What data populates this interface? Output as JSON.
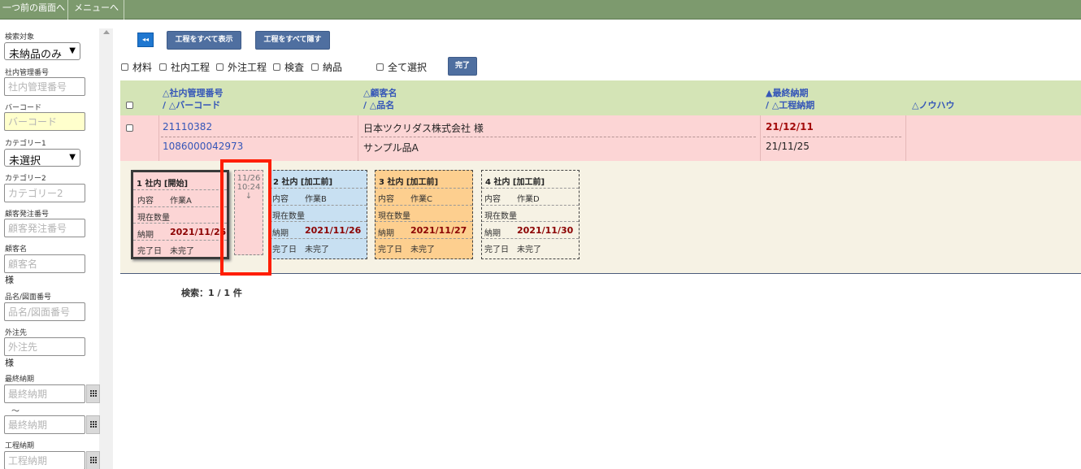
{
  "topbar": {
    "back_label": "一つ前の画面へ",
    "menu_label": "メニューへ"
  },
  "sidebar": {
    "search_target_label": "検索対象",
    "search_target_value": "未納品のみ",
    "internal_no_label": "社内管理番号",
    "internal_no_placeholder": "社内管理番号",
    "barcode_label": "バーコード",
    "barcode_placeholder": "バーコード",
    "category1_label": "カテゴリー1",
    "category1_value": "未選択",
    "category2_label": "カテゴリー2",
    "category2_placeholder": "カテゴリー2",
    "customer_po_label": "顧客発注番号",
    "customer_po_placeholder": "顧客発注番号",
    "customer_label": "顧客名",
    "customer_placeholder": "顧客名",
    "customer_suffix": "様",
    "product_label": "品名/図面番号",
    "product_placeholder": "品名/図面番号",
    "vendor_label": "外注先",
    "vendor_placeholder": "外注先",
    "vendor_suffix": "様",
    "final_due_label": "最終納期",
    "final_due_from_placeholder": "最終納期",
    "range_sep": "～",
    "final_due_to_placeholder": "最終納期",
    "proc_due_label": "工程納期",
    "proc_due_placeholder": "工程納期"
  },
  "toolbar": {
    "rewind_icon": "◂◂",
    "show_all_label": "工程をすべて表示",
    "hide_all_label": "工程をすべて隠す",
    "filters": [
      "材料",
      "社内工程",
      "外注工程",
      "検査",
      "納品"
    ],
    "select_all_label": "全て選択",
    "done_label": "完了"
  },
  "table": {
    "headers": {
      "internal_no": "△社内管理番号",
      "barcode": "/ △バーコード",
      "customer": "△顧客名",
      "product": "/ △品名",
      "final_due": "▲最終納期",
      "proc_due": "/ △工程納期",
      "knowhow": "△ノウハウ"
    },
    "row": {
      "internal_no": "21110382",
      "barcode": "1086000042973",
      "customer": "日本ツクリダス株式会社 様",
      "product": "サンプル品A",
      "final_due": "21/12/11",
      "proc_due": "21/11/25"
    }
  },
  "processes": [
    {
      "title": "1 社内 [開始]",
      "content_label": "内容",
      "content": "作業A",
      "qty_label": "現在数量",
      "due_label": "納期",
      "due": "2021/11/25",
      "done_label": "完了日",
      "done": "未完了"
    },
    {
      "title": "2 社内 [加工前]",
      "content_label": "内容",
      "content": "作業B",
      "qty_label": "現在数量",
      "due_label": "納期",
      "due": "2021/11/26",
      "done_label": "完了日",
      "done": "未完了"
    },
    {
      "title": "3 社内 [加工前]",
      "content_label": "内容",
      "content": "作業C",
      "qty_label": "現在数量",
      "due_label": "納期",
      "due": "2021/11/27",
      "done_label": "完了日",
      "done": "未完了"
    },
    {
      "title": "4 社内 [加工前]",
      "content_label": "内容",
      "content": "作業D",
      "qty_label": "現在数量",
      "due_label": "納期",
      "due": "2021/11/30",
      "done_label": "完了日",
      "done": "未完了"
    }
  ],
  "transition": {
    "date": "11/26",
    "time": "10:24",
    "arrow": "↓"
  },
  "result_text": "検索：1 / 1 件",
  "colors": {
    "topbar": "#7d9a6e",
    "header_row": "#d4e4b6",
    "data_row": "#fcd5d5",
    "highlight": "#ff1d00",
    "button": "#4f6fa0"
  }
}
